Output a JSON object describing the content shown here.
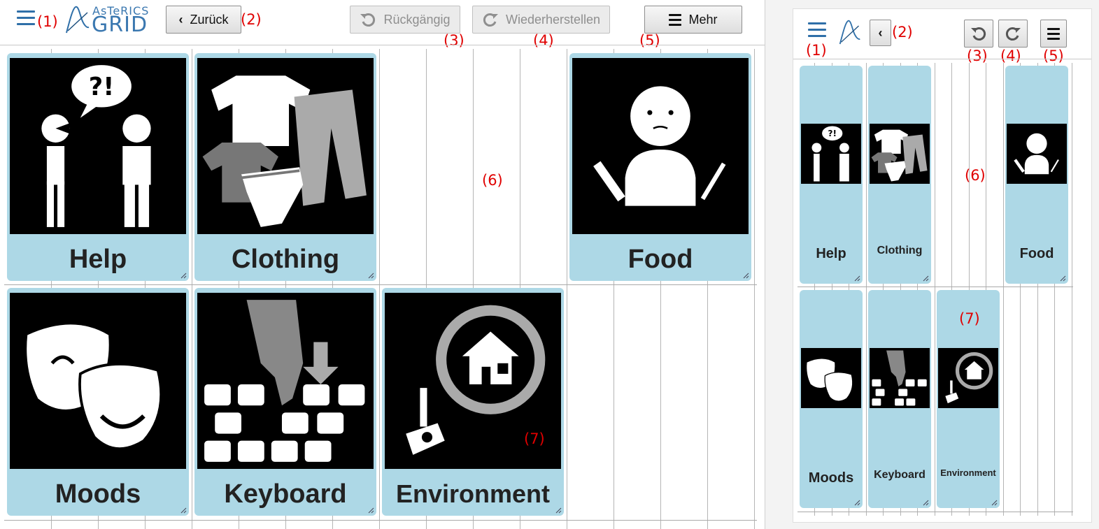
{
  "desktop": {
    "header": {
      "logo_top": "AsTeRICS",
      "logo_bottom": "GRID",
      "back_label": "Zurück",
      "undo_label": "Rückgängig",
      "redo_label": "Wiederherstellen",
      "more_label": "Mehr"
    },
    "tiles": [
      {
        "label": "Help",
        "icon": "help-pictogram-icon"
      },
      {
        "label": "Clothing",
        "icon": "clothing-pictogram-icon"
      },
      {
        "label": "Food",
        "icon": "food-pictogram-icon"
      },
      {
        "label": "Moods",
        "icon": "moods-pictogram-icon"
      },
      {
        "label": "Keyboard",
        "icon": "keyboard-pictogram-icon"
      },
      {
        "label": "Environment",
        "icon": "environment-pictogram-icon"
      }
    ]
  },
  "mobile": {
    "tiles": [
      {
        "label": "Help"
      },
      {
        "label": "Clothing"
      },
      {
        "label": "Food"
      },
      {
        "label": "Moods"
      },
      {
        "label": "Keyboard"
      },
      {
        "label": "Environment"
      }
    ]
  },
  "annotations": [
    "(1)",
    "(2)",
    "(3)",
    "(4)",
    "(5)",
    "(6)",
    "(7)"
  ],
  "colors": {
    "tile": "#add8e6",
    "annotation": "#e00000",
    "accent": "#3a7fbf"
  }
}
